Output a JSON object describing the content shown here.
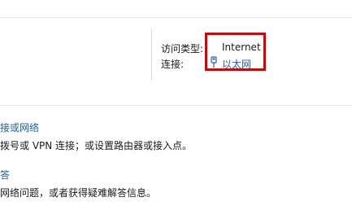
{
  "connection": {
    "access_type_label": "访问类型:",
    "access_type_value": "Internet",
    "connections_label": "连接:",
    "connection_name": "以太网"
  },
  "tasks": [
    {
      "title": "接或网络",
      "description": "拨号或 VPN 连接；或设置路由器或接入点。"
    },
    {
      "title": "答",
      "description": "网络问题，或者获得疑难解答信息。"
    }
  ],
  "colors": {
    "link": "#1a5fb4",
    "highlight": "#e00000",
    "text": "#1a1a1a"
  },
  "icons": {
    "connection_icon": "ethernet-icon"
  }
}
